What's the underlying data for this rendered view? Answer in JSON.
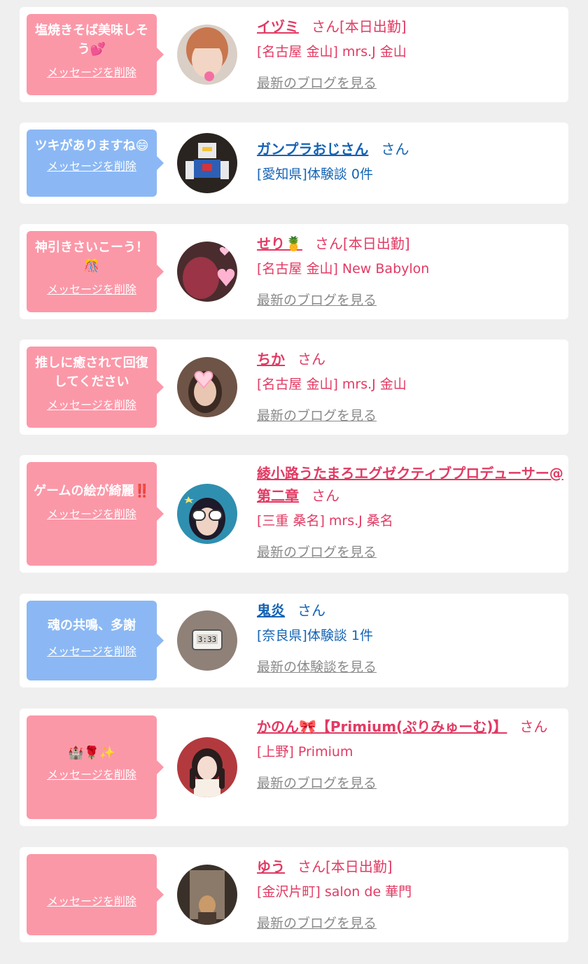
{
  "colors": {
    "page_bg": "#efefef",
    "card_bg": "#ffffff",
    "bubble_pink": "#fb98a8",
    "bubble_blue": "#8bb8f4",
    "text_pink": "#e23a63",
    "text_blue": "#1463b5",
    "link_gray": "#8a8a8a"
  },
  "common": {
    "delete_label": "メッセージを削除",
    "san": "さん"
  },
  "messages": [
    {
      "message": "塩焼きそば美味しそう💕",
      "theme": "pink",
      "name": "イヅミ",
      "status": "[本日出勤]",
      "shop": "[名古屋 金山] mrs.J 金山",
      "link": "最新のブログを見る",
      "avatar_icon": "woman-selfie-avatar"
    },
    {
      "message": "ツキがありますね😄",
      "theme": "blue",
      "name": "ガンプラおじさん",
      "status": "",
      "shop": "[愛知県]体験談 0件",
      "link": "",
      "avatar_icon": "robot-model-avatar"
    },
    {
      "message": "神引きさいこーう！🎊",
      "theme": "pink",
      "name": "せり🍍",
      "status": "[本日出勤]",
      "shop": "[名古屋 金山] New Babylon",
      "link": "最新のブログを見る",
      "avatar_icon": "heart-sticker-avatar"
    },
    {
      "message": "推しに癒されて回復してください",
      "theme": "pink",
      "name": "ちか",
      "status": "",
      "shop": "[名古屋 金山] mrs.J 金山",
      "link": "最新のブログを見る",
      "avatar_icon": "heart-sticker-avatar"
    },
    {
      "message": "ゲームの絵が綺麗‼️",
      "theme": "pink",
      "name": "綾小路うたまろエグゼクティブプロデューサー@第二章",
      "status": "",
      "shop": "[三重 桑名] mrs.J 桑名",
      "link": "最新のブログを見る",
      "avatar_icon": "sunglasses-avatar"
    },
    {
      "message": "魂の共鳴、多謝",
      "theme": "blue",
      "name": "鬼炎",
      "status": "",
      "shop": "[奈良県]体験談 1件",
      "link": "最新の体験談を見る",
      "avatar_icon": "clock-photo-avatar"
    },
    {
      "message": "🏰🌹✨",
      "theme": "pink",
      "name": "かのん🎀【Primium(ぷりみゅーむ)】",
      "status": "",
      "shop": "[上野] Primium",
      "link": "最新のブログを見る",
      "avatar_icon": "girl-portrait-avatar"
    },
    {
      "message": "",
      "theme": "pink",
      "name": "ゆう",
      "status": "[本日出勤]",
      "shop": "[金沢片町] salon de 華門",
      "link": "最新のブログを見る",
      "avatar_icon": "mirror-selfie-avatar"
    }
  ]
}
